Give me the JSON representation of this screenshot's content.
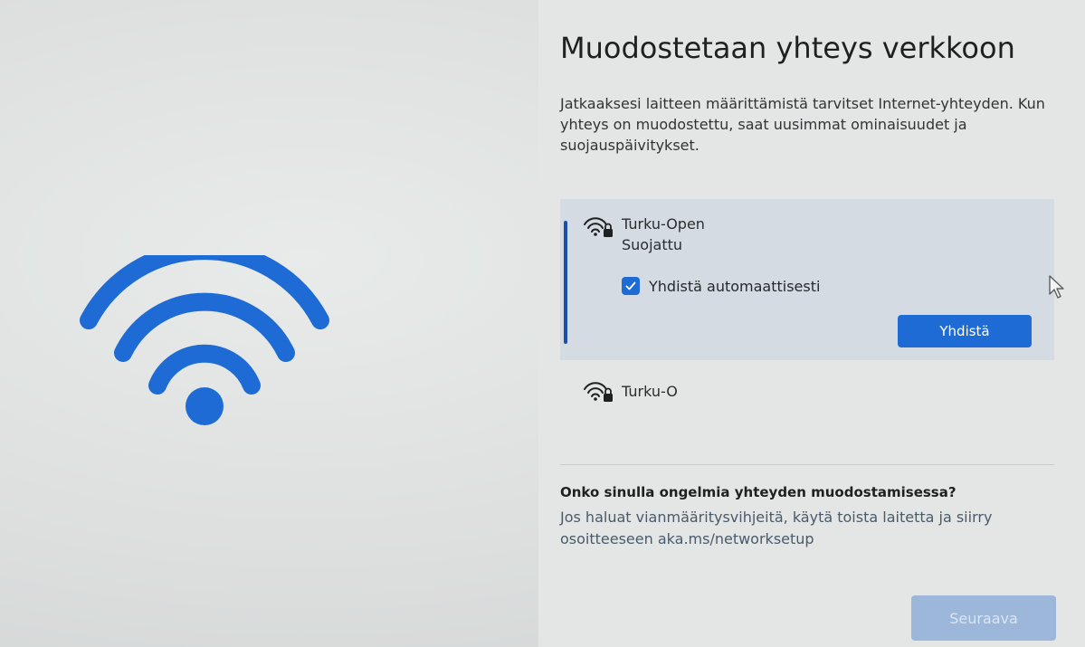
{
  "title": "Muodostetaan yhteys verkkoon",
  "description": "Jatkaaksesi laitteen määrittämistä tarvitset Internet-yhteyden. Kun yhteys on muodostettu, saat uusimmat ominaisuudet ja suojauspäivitykset.",
  "networks": [
    {
      "name": "Turku-Open",
      "status": "Suojattu",
      "icon": "wifi-secured-icon",
      "selected": true,
      "auto_connect_label": "Yhdistä automaattisesti",
      "auto_connect_checked": true,
      "connect_label": "Yhdistä"
    },
    {
      "name": "Turku-O",
      "icon": "wifi-secured-icon",
      "selected": false
    }
  ],
  "help": {
    "title": "Onko sinulla ongelmia yhteyden muodostamisessa?",
    "text": "Jos haluat vianmääritysvihjeitä, käytä toista laitetta ja siirry osoitteeseen aka.ms/networksetup"
  },
  "next_label": "Seuraava",
  "colors": {
    "accent": "#1e6bd6",
    "illustration": "#1e6bd6",
    "selected_indicator": "#1b4fa8",
    "disabled_button": "#9db7da"
  }
}
